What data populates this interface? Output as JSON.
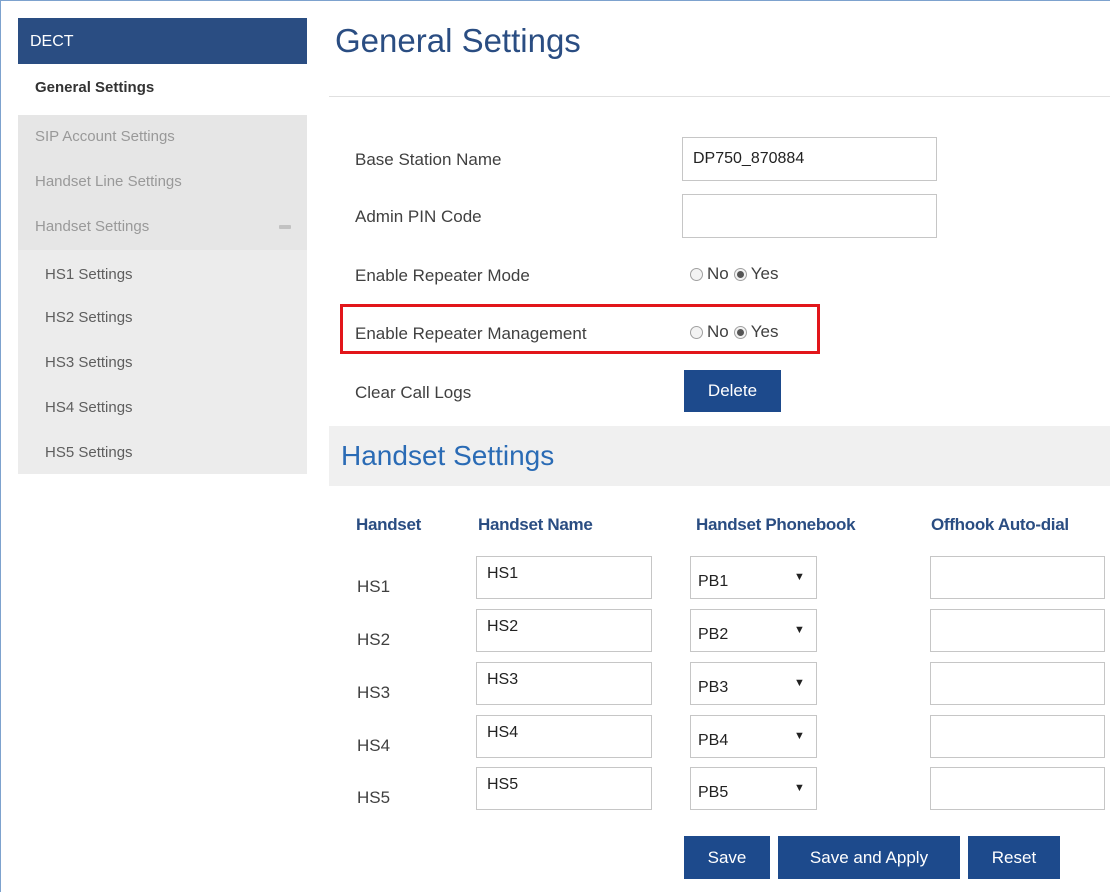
{
  "sidebar": {
    "header": "DECT",
    "active_item": "General Settings",
    "items": [
      {
        "label": "SIP Account Settings"
      },
      {
        "label": "Handset Line Settings"
      },
      {
        "label": "Handset Settings"
      }
    ],
    "sub_items": [
      {
        "label": "HS1 Settings"
      },
      {
        "label": "HS2 Settings"
      },
      {
        "label": "HS3 Settings"
      },
      {
        "label": "HS4 Settings"
      },
      {
        "label": "HS5 Settings"
      }
    ]
  },
  "page": {
    "title": "General Settings"
  },
  "form": {
    "base_station_label": "Base Station Name",
    "base_station_value": "DP750_870884",
    "admin_pin_label": "Admin PIN Code",
    "admin_pin_value": "",
    "repeater_mode_label": "Enable Repeater Mode",
    "repeater_mode_selected": "Yes",
    "repeater_mgmt_label": "Enable Repeater Management",
    "repeater_mgmt_selected": "Yes",
    "option_no": "No",
    "option_yes": "Yes",
    "clear_logs_label": "Clear Call Logs",
    "delete_button": "Delete"
  },
  "handset_section": {
    "title": "Handset Settings",
    "columns": [
      "Handset",
      "Handset Name",
      "Handset Phonebook",
      "Offhook Auto-dial"
    ],
    "rows": [
      {
        "handset": "HS1",
        "name": "HS1",
        "phonebook": "PB1",
        "autodial": ""
      },
      {
        "handset": "HS2",
        "name": "HS2",
        "phonebook": "PB2",
        "autodial": ""
      },
      {
        "handset": "HS3",
        "name": "HS3",
        "phonebook": "PB3",
        "autodial": ""
      },
      {
        "handset": "HS4",
        "name": "HS4",
        "phonebook": "PB4",
        "autodial": ""
      },
      {
        "handset": "HS5",
        "name": "HS5",
        "phonebook": "PB5",
        "autodial": ""
      }
    ]
  },
  "actions": {
    "save": "Save",
    "save_apply": "Save and Apply",
    "reset": "Reset"
  },
  "colors": {
    "nav_header": "#2a4d82",
    "button": "#1d4a8c",
    "section_title": "#2a6bb5",
    "highlight": "#e2161a"
  },
  "icons": {
    "collapse": "minus-icon",
    "select_caret": "caret-down-icon"
  }
}
